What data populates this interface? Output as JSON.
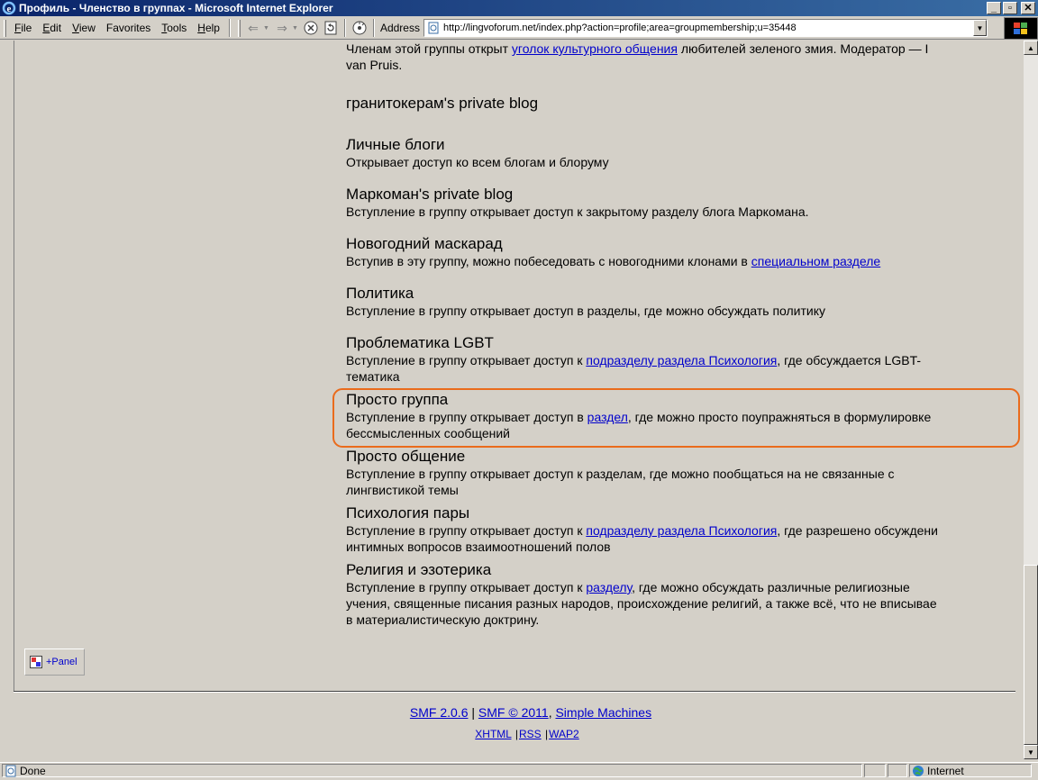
{
  "window": {
    "title": "Профиль - Членство в группах - Microsoft Internet Explorer",
    "minimize_glyph": "_",
    "maximize_glyph": "▫",
    "close_glyph": "✕"
  },
  "menu": {
    "items": [
      {
        "key": "F",
        "rest": "ile"
      },
      {
        "key": "E",
        "rest": "dit"
      },
      {
        "key": "V",
        "rest": "iew"
      },
      {
        "key": "F",
        "rest": "avorites",
        "plain_first": true
      },
      {
        "key": "T",
        "rest": "ools"
      },
      {
        "key": "H",
        "rest": "elp"
      }
    ]
  },
  "address": {
    "label": "Address",
    "url": "http://lingvoforum.net/index.php?action=profile;area=groupmembership;u=35448"
  },
  "page": {
    "top_fragment": {
      "pre": "Членам этой группы открыт ",
      "link": "уголок культурного общения",
      "post": " любителей зеленого змия. Модератор — I",
      "line2": "van Pruis."
    },
    "groups": [
      {
        "name": "гранитокерам's private blog",
        "desc_pre": "",
        "link": "",
        "desc_post": "",
        "line2": ""
      },
      {
        "name": "Личные блоги",
        "desc_pre": "Открывает доступ ко всем блогам и блоруму",
        "link": "",
        "desc_post": "",
        "line2": ""
      },
      {
        "name": "Маркоман's private blog",
        "desc_pre": "Вступление в группу открывает доступ к закрытому разделу блога Маркомана.",
        "link": "",
        "desc_post": "",
        "line2": ""
      },
      {
        "name": "Новогодний маскарад",
        "desc_pre": "Вступив в эту группу, можно побеседовать с новогодними клонами в ",
        "link": "специальном разделе",
        "desc_post": "",
        "line2": ""
      },
      {
        "name": "Политика",
        "desc_pre": "Вступление в группу открывает доступ в разделы, где можно обсуждать политику",
        "link": "",
        "desc_post": "",
        "line2": ""
      },
      {
        "name": "Проблематика LGBT",
        "desc_pre": "Вступление в группу открывает доступ к ",
        "link": "подразделу раздела Психология",
        "desc_post": ", где обсуждается LGBT-",
        "line2": "тематика"
      },
      {
        "name": "Просто группа",
        "desc_pre": "Вступление в группу открывает доступ в ",
        "link": "раздел",
        "desc_post": ", где можно просто поупражняться в формулировке",
        "line2": "бессмысленных сообщений"
      },
      {
        "name": "Просто общение",
        "desc_pre": "Вступление в группу открывает доступ к разделам, где можно пообщаться на не связанные с",
        "link": "",
        "desc_post": "",
        "line2": "лингвистикой темы"
      },
      {
        "name": "Психология пары",
        "desc_pre": "Вступление в группу открывает доступ к ",
        "link": "подразделу раздела Психология",
        "desc_post": ", где разрешено обсуждени",
        "line2": "интимных вопросов взаимоотношений полов"
      },
      {
        "name": "Религия и эзотерика",
        "desc_pre": "Вступление в группу открывает доступ к ",
        "link": "разделу",
        "desc_post": ", где можно обсуждать различные религиозные",
        "line2": "учения, священные писания разных народов, происхождение религий, а также всё, что не вписывае",
        "line3": "в материалистическую доктрину."
      }
    ],
    "panel_label": "+Panel",
    "footer": {
      "smf_version": "SMF 2.0.6",
      "smf_copyright": "SMF © 2011",
      "simple_machines": "Simple Machines",
      "sep1": "|",
      "sep2": ",",
      "xhtml": "XHTML",
      "rss": "RSS",
      "wap2": "WAP2",
      "bar": "|"
    }
  },
  "status": {
    "text": "Done",
    "zone": "Internet"
  },
  "colors": {
    "highlight": "#ea6b1c",
    "link": "#0000cc",
    "chrome": "#d4d0c8"
  }
}
